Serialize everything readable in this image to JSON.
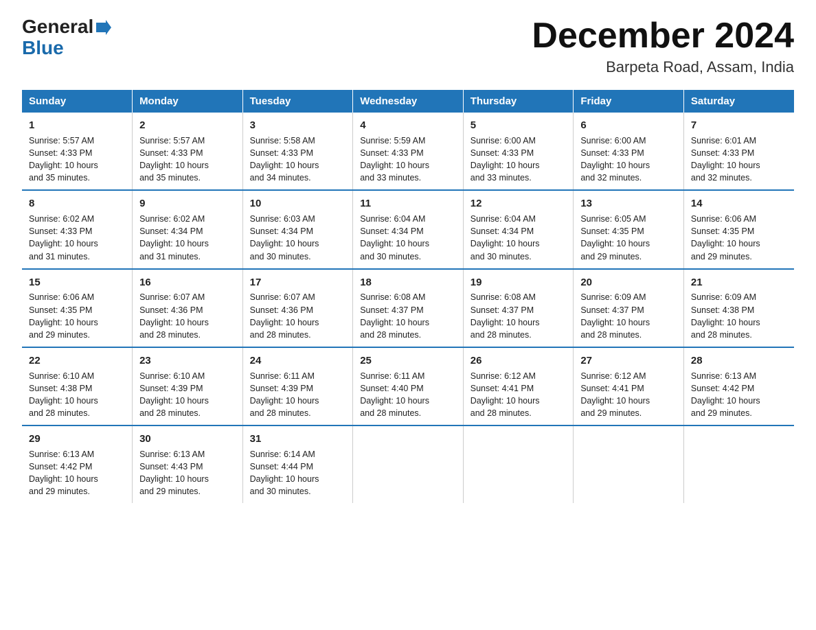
{
  "header": {
    "logo_general": "General",
    "logo_blue": "Blue",
    "month_title": "December 2024",
    "location": "Barpeta Road, Assam, India"
  },
  "weekdays": [
    "Sunday",
    "Monday",
    "Tuesday",
    "Wednesday",
    "Thursday",
    "Friday",
    "Saturday"
  ],
  "weeks": [
    [
      {
        "day": "1",
        "info": "Sunrise: 5:57 AM\nSunset: 4:33 PM\nDaylight: 10 hours\nand 35 minutes."
      },
      {
        "day": "2",
        "info": "Sunrise: 5:57 AM\nSunset: 4:33 PM\nDaylight: 10 hours\nand 35 minutes."
      },
      {
        "day": "3",
        "info": "Sunrise: 5:58 AM\nSunset: 4:33 PM\nDaylight: 10 hours\nand 34 minutes."
      },
      {
        "day": "4",
        "info": "Sunrise: 5:59 AM\nSunset: 4:33 PM\nDaylight: 10 hours\nand 33 minutes."
      },
      {
        "day": "5",
        "info": "Sunrise: 6:00 AM\nSunset: 4:33 PM\nDaylight: 10 hours\nand 33 minutes."
      },
      {
        "day": "6",
        "info": "Sunrise: 6:00 AM\nSunset: 4:33 PM\nDaylight: 10 hours\nand 32 minutes."
      },
      {
        "day": "7",
        "info": "Sunrise: 6:01 AM\nSunset: 4:33 PM\nDaylight: 10 hours\nand 32 minutes."
      }
    ],
    [
      {
        "day": "8",
        "info": "Sunrise: 6:02 AM\nSunset: 4:33 PM\nDaylight: 10 hours\nand 31 minutes."
      },
      {
        "day": "9",
        "info": "Sunrise: 6:02 AM\nSunset: 4:34 PM\nDaylight: 10 hours\nand 31 minutes."
      },
      {
        "day": "10",
        "info": "Sunrise: 6:03 AM\nSunset: 4:34 PM\nDaylight: 10 hours\nand 30 minutes."
      },
      {
        "day": "11",
        "info": "Sunrise: 6:04 AM\nSunset: 4:34 PM\nDaylight: 10 hours\nand 30 minutes."
      },
      {
        "day": "12",
        "info": "Sunrise: 6:04 AM\nSunset: 4:34 PM\nDaylight: 10 hours\nand 30 minutes."
      },
      {
        "day": "13",
        "info": "Sunrise: 6:05 AM\nSunset: 4:35 PM\nDaylight: 10 hours\nand 29 minutes."
      },
      {
        "day": "14",
        "info": "Sunrise: 6:06 AM\nSunset: 4:35 PM\nDaylight: 10 hours\nand 29 minutes."
      }
    ],
    [
      {
        "day": "15",
        "info": "Sunrise: 6:06 AM\nSunset: 4:35 PM\nDaylight: 10 hours\nand 29 minutes."
      },
      {
        "day": "16",
        "info": "Sunrise: 6:07 AM\nSunset: 4:36 PM\nDaylight: 10 hours\nand 28 minutes."
      },
      {
        "day": "17",
        "info": "Sunrise: 6:07 AM\nSunset: 4:36 PM\nDaylight: 10 hours\nand 28 minutes."
      },
      {
        "day": "18",
        "info": "Sunrise: 6:08 AM\nSunset: 4:37 PM\nDaylight: 10 hours\nand 28 minutes."
      },
      {
        "day": "19",
        "info": "Sunrise: 6:08 AM\nSunset: 4:37 PM\nDaylight: 10 hours\nand 28 minutes."
      },
      {
        "day": "20",
        "info": "Sunrise: 6:09 AM\nSunset: 4:37 PM\nDaylight: 10 hours\nand 28 minutes."
      },
      {
        "day": "21",
        "info": "Sunrise: 6:09 AM\nSunset: 4:38 PM\nDaylight: 10 hours\nand 28 minutes."
      }
    ],
    [
      {
        "day": "22",
        "info": "Sunrise: 6:10 AM\nSunset: 4:38 PM\nDaylight: 10 hours\nand 28 minutes."
      },
      {
        "day": "23",
        "info": "Sunrise: 6:10 AM\nSunset: 4:39 PM\nDaylight: 10 hours\nand 28 minutes."
      },
      {
        "day": "24",
        "info": "Sunrise: 6:11 AM\nSunset: 4:39 PM\nDaylight: 10 hours\nand 28 minutes."
      },
      {
        "day": "25",
        "info": "Sunrise: 6:11 AM\nSunset: 4:40 PM\nDaylight: 10 hours\nand 28 minutes."
      },
      {
        "day": "26",
        "info": "Sunrise: 6:12 AM\nSunset: 4:41 PM\nDaylight: 10 hours\nand 28 minutes."
      },
      {
        "day": "27",
        "info": "Sunrise: 6:12 AM\nSunset: 4:41 PM\nDaylight: 10 hours\nand 29 minutes."
      },
      {
        "day": "28",
        "info": "Sunrise: 6:13 AM\nSunset: 4:42 PM\nDaylight: 10 hours\nand 29 minutes."
      }
    ],
    [
      {
        "day": "29",
        "info": "Sunrise: 6:13 AM\nSunset: 4:42 PM\nDaylight: 10 hours\nand 29 minutes."
      },
      {
        "day": "30",
        "info": "Sunrise: 6:13 AM\nSunset: 4:43 PM\nDaylight: 10 hours\nand 29 minutes."
      },
      {
        "day": "31",
        "info": "Sunrise: 6:14 AM\nSunset: 4:44 PM\nDaylight: 10 hours\nand 30 minutes."
      },
      {
        "day": "",
        "info": ""
      },
      {
        "day": "",
        "info": ""
      },
      {
        "day": "",
        "info": ""
      },
      {
        "day": "",
        "info": ""
      }
    ]
  ]
}
